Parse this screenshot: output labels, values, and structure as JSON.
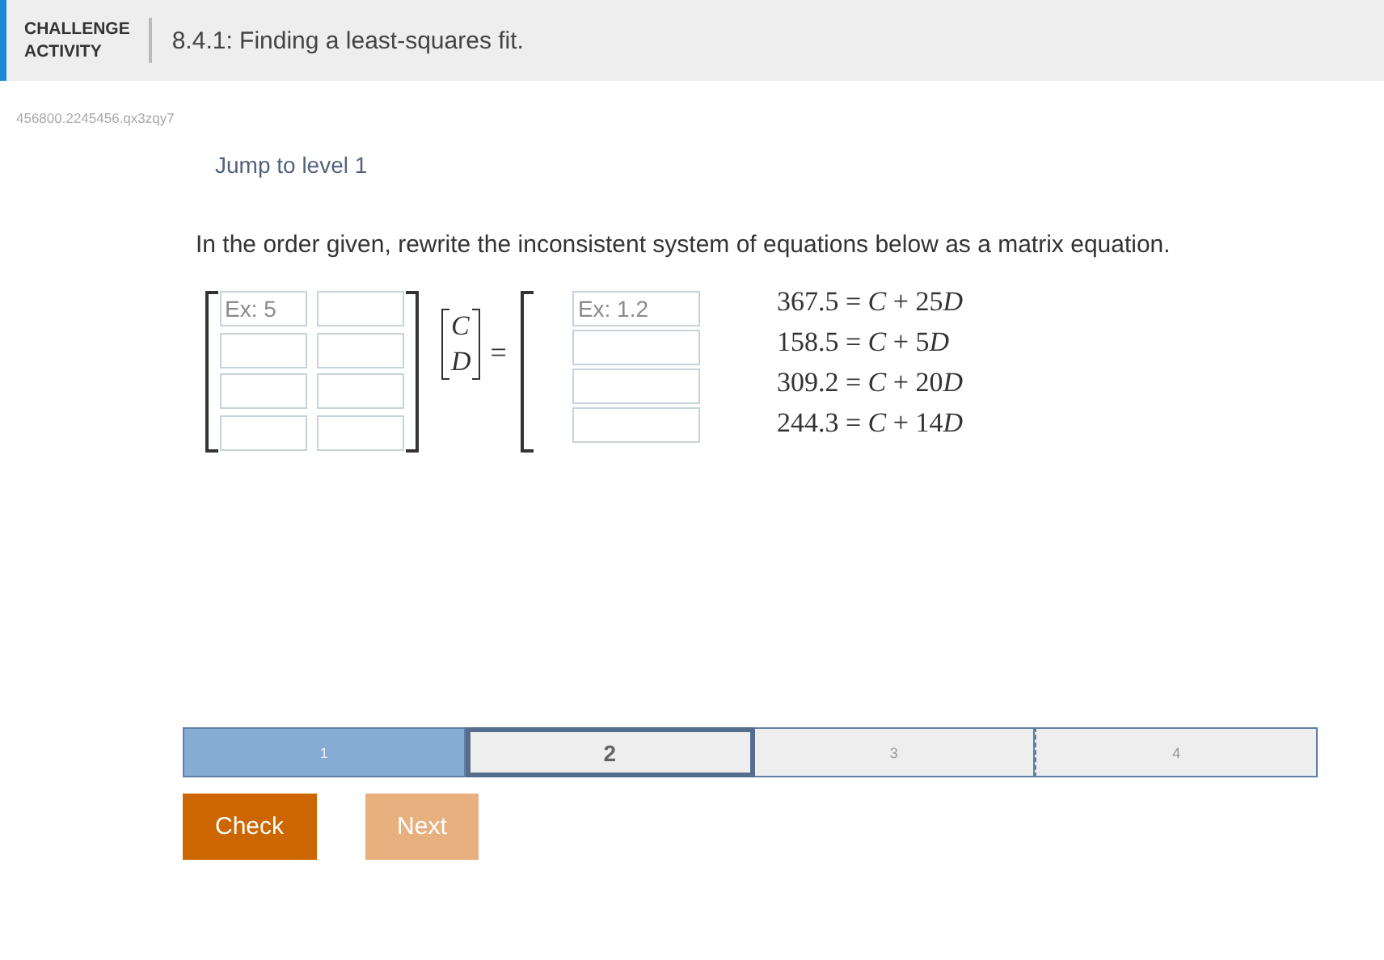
{
  "header": {
    "badge_line_1": "CHALLENGE",
    "badge_line_2": "ACTIVITY",
    "title": "8.4.1: Finding a least-squares fit."
  },
  "activity_id": "456800.2245456.qx3zqy7",
  "jump_link": "Jump to level 1",
  "instructions": "In the order given, rewrite the inconsistent system of equations below as a matrix equation.",
  "coefficient_matrix": [
    [
      {
        "kind": "field",
        "placeholder": "Ex: 5"
      },
      {
        "kind": "field"
      }
    ],
    [
      {
        "kind": "field"
      },
      {
        "kind": "field"
      }
    ],
    [
      {
        "kind": "field"
      },
      {
        "kind": "field"
      }
    ],
    [
      {
        "kind": "field"
      },
      {
        "kind": "field"
      }
    ]
  ],
  "unknowns": [
    "C",
    "D"
  ],
  "equals": "=",
  "right_side": [
    {
      "kind": "field",
      "placeholder": "Ex: 1.2"
    },
    {
      "kind": "field"
    },
    {
      "kind": "field"
    },
    {
      "kind": "field"
    }
  ],
  "equations": [
    {
      "value": "367.5",
      "equals": "=",
      "variable_1": "C",
      "plus": "+",
      "coefficient": "25",
      "variable_2": "D"
    },
    {
      "value": "158.5",
      "equals": "=",
      "variable_1": "C",
      "plus": "+",
      "coefficient": "5",
      "variable_2": "D"
    },
    {
      "value": "309.2",
      "equals": "=",
      "variable_1": "C",
      "plus": "+",
      "coefficient": "20",
      "variable_2": "D"
    },
    {
      "value": "244.3",
      "equals": "=",
      "variable_1": "C",
      "plus": "+",
      "coefficient": "14",
      "variable_2": "D"
    }
  ],
  "levels": [
    {
      "label": "1",
      "completed": true,
      "selected": false
    },
    {
      "label": "2",
      "completed": false,
      "selected": true
    },
    {
      "label": "3",
      "completed": false,
      "selected": false
    },
    {
      "label": "4",
      "completed": false,
      "selected": false
    }
  ],
  "buttons": [
    {
      "label": "Check",
      "disabled": false
    },
    {
      "label": "Next",
      "disabled": true
    }
  ]
}
